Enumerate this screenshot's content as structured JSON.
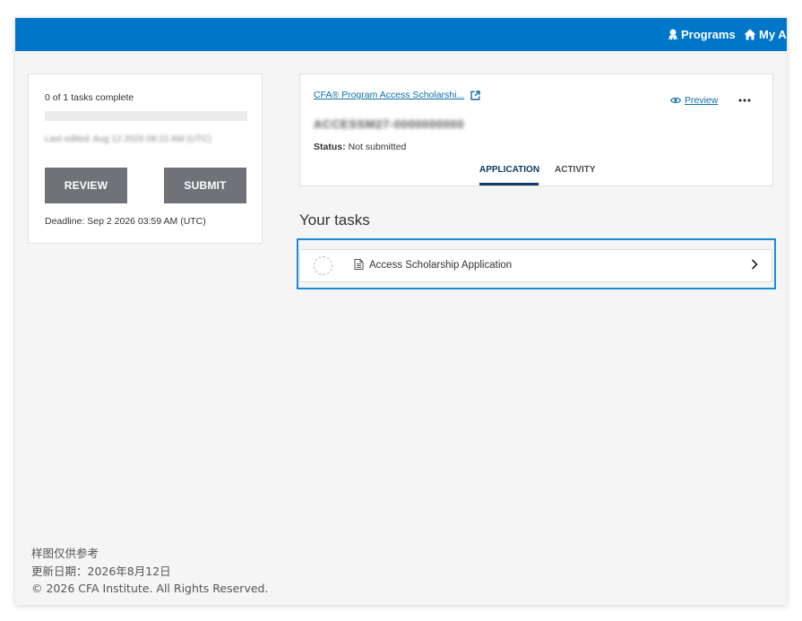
{
  "colors": {
    "header_bg": "#0076c8",
    "link": "#0f6ea6",
    "button_bg": "#6f7378",
    "task_highlight": "#1a8dd1",
    "active_tab": "#0d3b66"
  },
  "header": {
    "nav": [
      {
        "label": "Programs",
        "icon": "award-user-icon"
      },
      {
        "label": "My Ap",
        "icon": "home-icon"
      }
    ]
  },
  "summary_card": {
    "progress_text": "0 of 1 tasks complete",
    "progress": 0,
    "last_edited": "Last edited: Aug 12 2026 08:22 AM (UTC)",
    "review_label": "REVIEW",
    "submit_label": "SUBMIT",
    "deadline": "Deadline: Sep 2 2026 03:59 AM (UTC)"
  },
  "application_card": {
    "program_link": "CFA® Program Access Scholarshi...",
    "program_link_icon": "external-link-icon",
    "preview_label": "Preview",
    "preview_icon": "eye-icon",
    "more_icon": "more-options-icon",
    "application_id": "ACCESSM27-0000000000",
    "status_label": "Status:",
    "status_value": "Not submitted",
    "tabs": [
      {
        "label": "APPLICATION",
        "active": true
      },
      {
        "label": "ACTIVITY",
        "active": false
      }
    ]
  },
  "tasks": {
    "heading": "Your tasks",
    "items": [
      {
        "label": "Access Scholarship Application",
        "icon": "document-icon",
        "complete": false
      }
    ]
  },
  "footer": {
    "lines": [
      "样图仅供参考",
      "更新日期：2026年8月12日",
      "© 2026 CFA Institute. All Rights Reserved."
    ]
  }
}
